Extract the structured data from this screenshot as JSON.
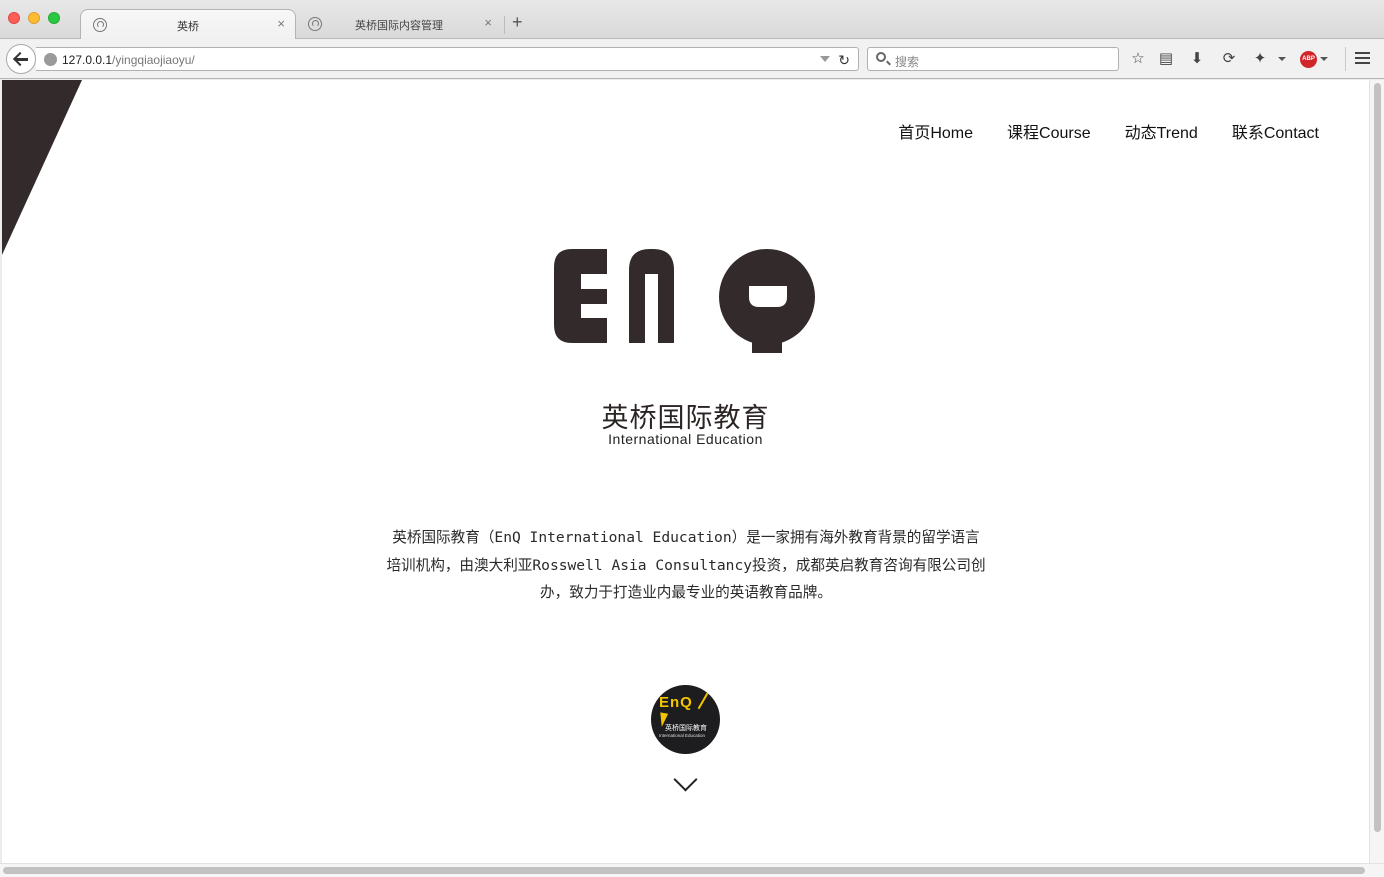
{
  "browser": {
    "tabs": [
      {
        "title": "英桥",
        "active": true
      },
      {
        "title": "英桥国际内容管理",
        "active": false
      }
    ],
    "url_host": "127.0.0.1",
    "url_path": "/yingqiaojiaoyu/",
    "search_placeholder": "搜索",
    "abp_label": "ABP",
    "new_tab_label": "+",
    "tab_close_label": "×"
  },
  "site": {
    "nav": [
      {
        "label": "首页Home"
      },
      {
        "label": "课程Course"
      },
      {
        "label": "动态Trend"
      },
      {
        "label": "联系Contact"
      }
    ],
    "brand_cn": "英桥国际教育",
    "brand_en": "International Education",
    "intro": "英桥国际教育（EnQ International Education）是一家拥有海外教育背景的留学语言培训机构，由澳大利亚Rosswell Asia Consultancy投资，成都英启教育咨询有限公司创办，致力于打造业内最专业的英语教育品牌。",
    "badge_enq": "EnQ",
    "badge_cn": "英桥国际教育",
    "badge_en": "International Education",
    "colors": {
      "brand_dark": "#332b2b",
      "badge_bg": "#1d1d1f",
      "badge_accent": "#f2c500"
    }
  }
}
